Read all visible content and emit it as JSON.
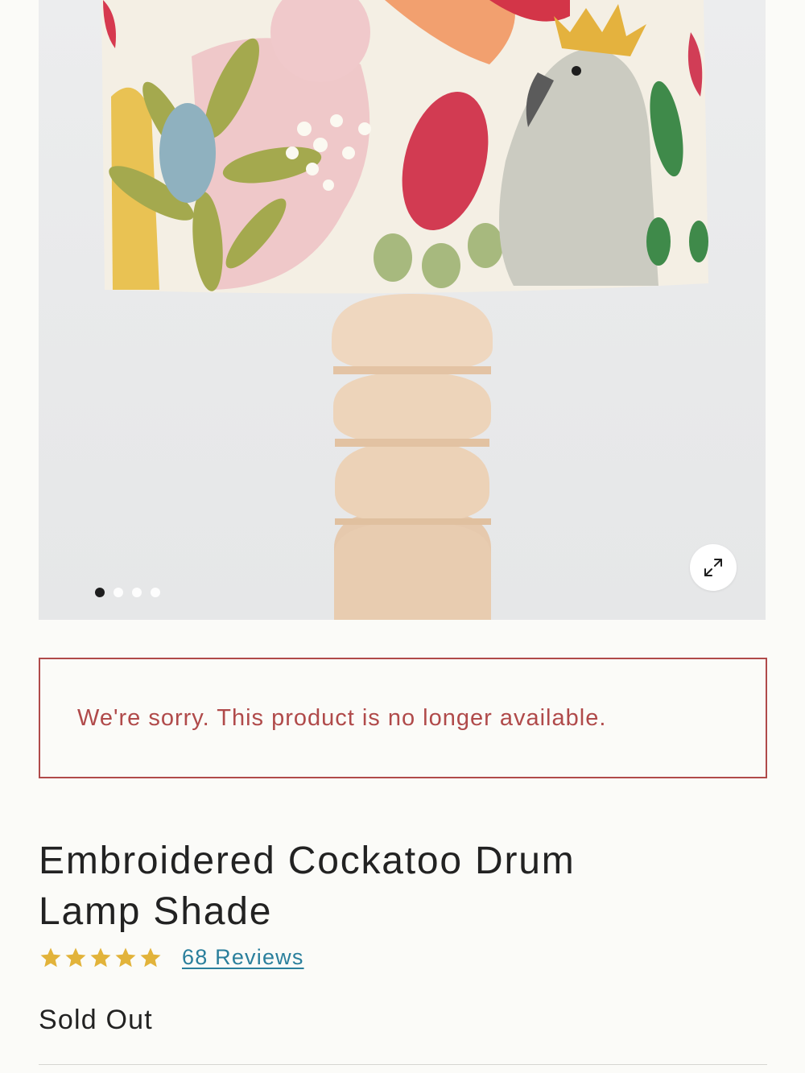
{
  "carousel": {
    "image_alt": "Embroidered Cockatoo Drum Lamp Shade",
    "total_slides": 4,
    "active_slide": 1,
    "expand_icon": "expand-arrows-icon"
  },
  "notice": {
    "text": "We're sorry. This product is no longer available.",
    "color": "#b04a4a"
  },
  "product": {
    "title": "Embroidered Cockatoo Drum Lamp Shade",
    "rating": 5,
    "rating_max": 5,
    "star_color": "#e2b33a",
    "reviews_label": "68 Reviews",
    "status": "Sold Out"
  },
  "theme": {
    "link_color": "#2a7f9c",
    "background": "#fbfbf8"
  }
}
